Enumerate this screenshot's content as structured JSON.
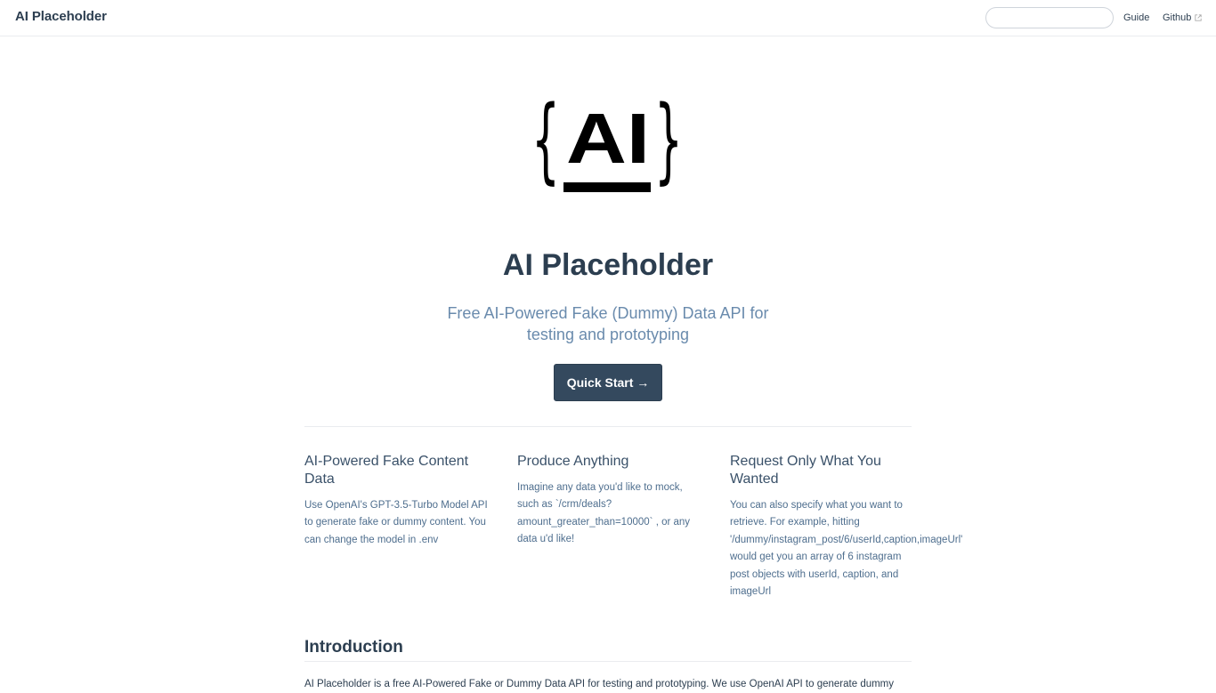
{
  "navbar": {
    "brand": "AI Placeholder",
    "search": {
      "value": "",
      "placeholder": ""
    },
    "links": {
      "guide": "Guide",
      "github": "Github"
    }
  },
  "hero": {
    "logo": {
      "left_brace": "{",
      "letters": "AI",
      "right_brace": "}"
    },
    "title": "AI Placeholder",
    "description_line1": "Free AI-Powered Fake (Dummy) Data API for",
    "description_line2": "testing and prototyping",
    "action_label": "Quick Start →"
  },
  "features": [
    {
      "title_line1": "AI-Powered Fake Content",
      "title_line2": "Data",
      "lines": [
        "Use OpenAI's GPT-3.5-Turbo Model API",
        "to generate fake or dummy content. You",
        "can change the model in .env"
      ]
    },
    {
      "title_line1": "Produce Anything",
      "title_line2": "",
      "lines": [
        "Imagine any data you'd like to mock,",
        "such as `/crm/deals?",
        "amount_greater_than=10000` , or any",
        "data u'd like!"
      ]
    },
    {
      "title_line1": "Request Only What You",
      "title_line2": "Wanted",
      "lines": [
        "You can also specify what you want to",
        "retrieve. For example, hitting",
        "'/dummy/instagram_post/6/userId,caption,imageUrl'",
        "would get you an array of 6 instagram",
        "post objects with userId, caption, and",
        "imageUrl"
      ]
    }
  ],
  "introduction": {
    "title": "Introduction",
    "text": "AI Placeholder is a free AI-Powered Fake or Dummy Data API for testing and prototyping. We use OpenAI API to generate dummy"
  },
  "colors": {
    "text_primary": "#2c3e50",
    "text_muted": "#6a8bad",
    "button_bg": "#34495e",
    "border": "#eaecef"
  },
  "icons": {
    "external": "external-link-icon"
  }
}
